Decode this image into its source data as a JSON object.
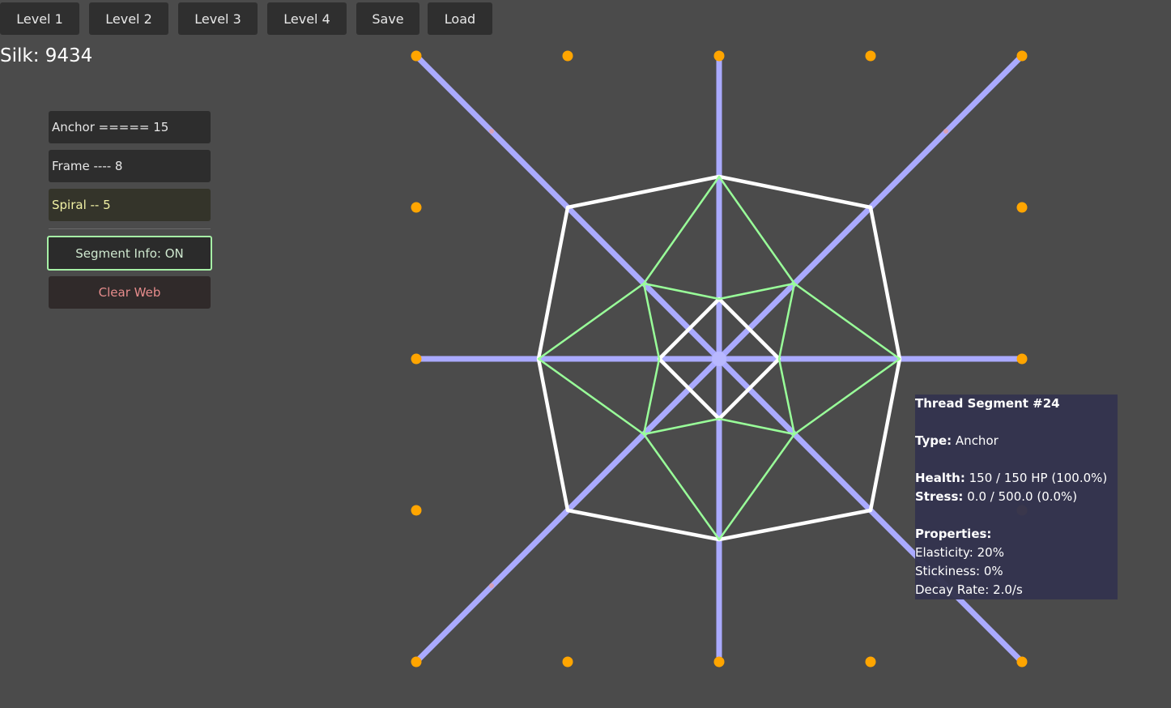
{
  "toolbar": {
    "buttons": [
      "Level 1",
      "Level 2",
      "Level 3",
      "Level 4",
      "Save",
      "Load"
    ]
  },
  "silk_label": "Silk: 9434",
  "thread_types": {
    "anchor": "Anchor ===== 15",
    "frame": "Frame ---- 8",
    "spiral": "Spiral -- 5",
    "selected": "spiral"
  },
  "segment_info_toggle": "Segment Info: ON",
  "clear_web": "Clear Web",
  "tooltip": {
    "title": "Thread Segment #24",
    "type_label": "Type:",
    "type_value": "Anchor",
    "health_label": "Health:",
    "health_value": "150 / 150 HP (100.0%)",
    "stress_label": "Stress:",
    "stress_value": "0.0 / 500.0 (0.0%)",
    "properties_label": "Properties:",
    "elasticity": "Elasticity: 20%",
    "stickiness": "Stickiness: 0%",
    "decay": "Decay Rate: 2.0/s"
  },
  "colors": {
    "background": "#4b4b4b",
    "anchor_thread": "#aaaaff",
    "frame_thread": "#ffffff",
    "spiral_thread": "#99ff99",
    "anchor_point": "#ffa500"
  }
}
